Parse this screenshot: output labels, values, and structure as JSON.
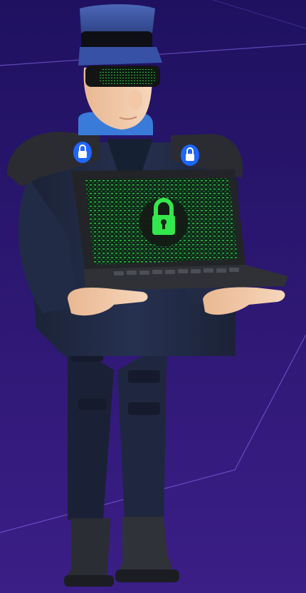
{
  "scene": {
    "subject": "security-guard-character",
    "props": [
      "laptop",
      "padlock-icon",
      "shoulder-lock-badges",
      "visor-sunglasses",
      "police-cap"
    ],
    "colors": {
      "background_top": "#1f1160",
      "background_bottom": "#3b1e86",
      "accent_line": "#7d5fe0",
      "uniform": "#1e2740",
      "uniform_shadow": "#141a2e",
      "cap_blue": "#3f5aa8",
      "skin": "#f0c9a8",
      "screen_bg": "#0f2a1a",
      "code_green": "#2fdc4a",
      "lock_green": "#33e84a",
      "badge_blue": "#1e66ff"
    }
  }
}
